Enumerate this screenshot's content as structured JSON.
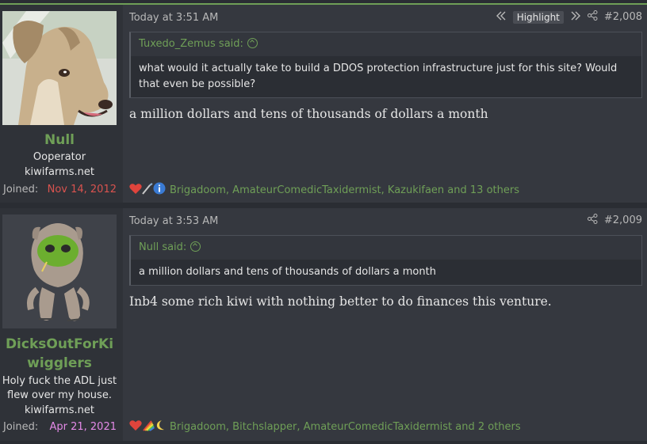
{
  "posts": [
    {
      "user": {
        "name": "Null",
        "title": "Ooperator",
        "site": "kiwifarms.net",
        "joined_label": "Joined:",
        "joined_date": "Nov 14, 2012",
        "joined_color": "#d9534f"
      },
      "timestamp": "Today at 3:51 AM",
      "highlight_label": "Highlight",
      "post_number": "#2,008",
      "quote": {
        "author": "Tuxedo_Zemus said:",
        "text": "what would it actually take to build a DDOS protection infrastructure just for this site? Would that even be possible?"
      },
      "body": "a million dollars and tens of thousands of dollars a month",
      "reactions": {
        "icons": [
          "heart-icon",
          "scalpel-icon",
          "info-icon"
        ],
        "text": "Brigadoom, AmateurComedicTaxidermist, Kazukifaen and 13 others"
      }
    },
    {
      "user": {
        "name": "DicksOutForKi wigglers",
        "title": "Holy fuck the ADL just flew over my house.",
        "site": "kiwifarms.net",
        "joined_label": "Joined:",
        "joined_date": "Apr 21, 2021",
        "joined_color": "#e48ae8"
      },
      "timestamp": "Today at 3:53 AM",
      "post_number": "#2,009",
      "quote": {
        "author": "Null said:",
        "text": "a million dollars and tens of thousands of dollars a month"
      },
      "body": "Inb4 some rich kiwi with nothing better to do finances this venture.",
      "reactions": {
        "icons": [
          "heart-icon",
          "rainbow-icon",
          "moon-icon"
        ],
        "text": "Brigadoom, Bitchslapper, AmateurComedicTaxidermist and 2 others"
      }
    }
  ],
  "colors": {
    "accent": "#6f9f57",
    "background": "#2a2d33",
    "post_bg": "#35383f"
  }
}
